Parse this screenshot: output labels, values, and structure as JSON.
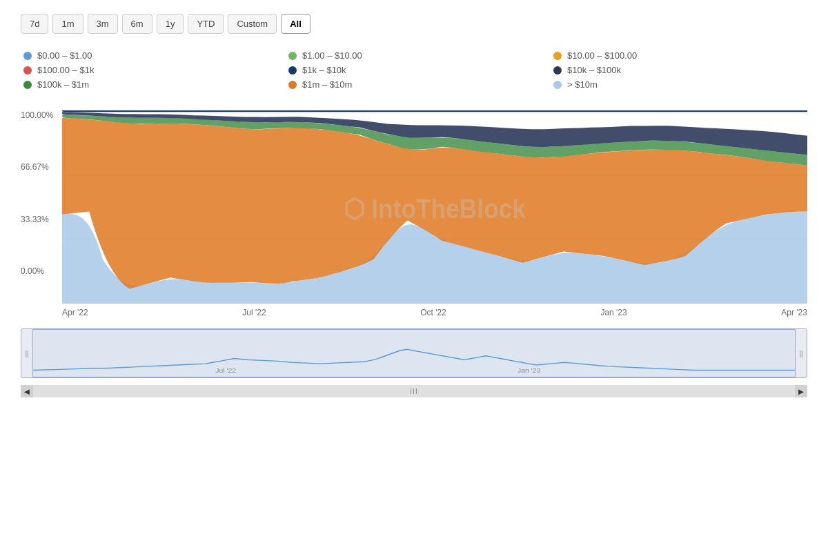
{
  "timeRange": {
    "buttons": [
      {
        "label": "7d",
        "active": false
      },
      {
        "label": "1m",
        "active": false
      },
      {
        "label": "3m",
        "active": false
      },
      {
        "label": "6m",
        "active": false
      },
      {
        "label": "1y",
        "active": false
      },
      {
        "label": "YTD",
        "active": false
      },
      {
        "label": "Custom",
        "active": false
      },
      {
        "label": "All",
        "active": true
      }
    ]
  },
  "legend": [
    {
      "color": "#5b9bd5",
      "label": "$0.00 – $1.00"
    },
    {
      "color": "#70b860",
      "label": "$1.00 – $10.00"
    },
    {
      "color": "#e8a020",
      "label": "$10.00 – $100.00"
    },
    {
      "color": "#d9534f",
      "label": "$100.00 – $1k"
    },
    {
      "color": "#1a3a6b",
      "label": "$1k – $10k"
    },
    {
      "color": "#2d3a5a",
      "label": "$10k – $100k"
    },
    {
      "color": "#3a8a40",
      "label": "$100k – $1m"
    },
    {
      "color": "#e07820",
      "label": "$1m – $10m"
    },
    {
      "color": "#a8c8e8",
      "label": "> $10m"
    }
  ],
  "yAxis": {
    "labels": [
      "100.00%",
      "66.67%",
      "33.33%",
      "0.00%"
    ]
  },
  "xAxis": {
    "labels": [
      "Apr '22",
      "Jul '22",
      "Oct '22",
      "Jan '23",
      "Apr '23"
    ]
  },
  "watermark": "IntoTheBlock",
  "scrollbar": {
    "centerLabel": "III",
    "leftArrow": "◄",
    "rightArrow": "►"
  },
  "minimapXLabels": [
    "Jul '22",
    "Jan '23"
  ]
}
